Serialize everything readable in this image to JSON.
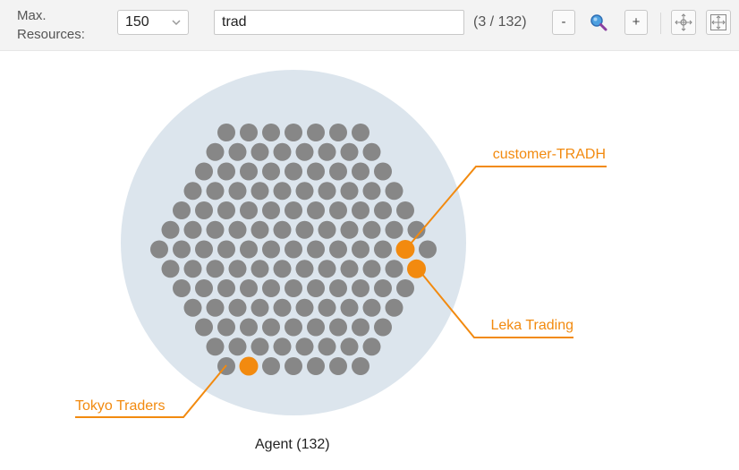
{
  "toolbar": {
    "max_label_line1": "Max.",
    "max_label_line2": "Resources:",
    "max_value": "150",
    "search_value": "trad",
    "match_count": "(3 / 132)",
    "zoom_out_label": "-",
    "zoom_in_label": "+",
    "icons": [
      "chevron-down-icon",
      "magnifier-icon",
      "center-icon",
      "fit-to-screen-icon"
    ]
  },
  "visualization": {
    "group_label": "Agent (132)",
    "colors": {
      "circle_bg": "#dce5ed",
      "node": "#878787",
      "highlight": "#f28a0f"
    },
    "callouts": [
      {
        "label": "customer-TRADH"
      },
      {
        "label": "Leka Trading"
      },
      {
        "label": "Tokyo Traders"
      }
    ]
  }
}
